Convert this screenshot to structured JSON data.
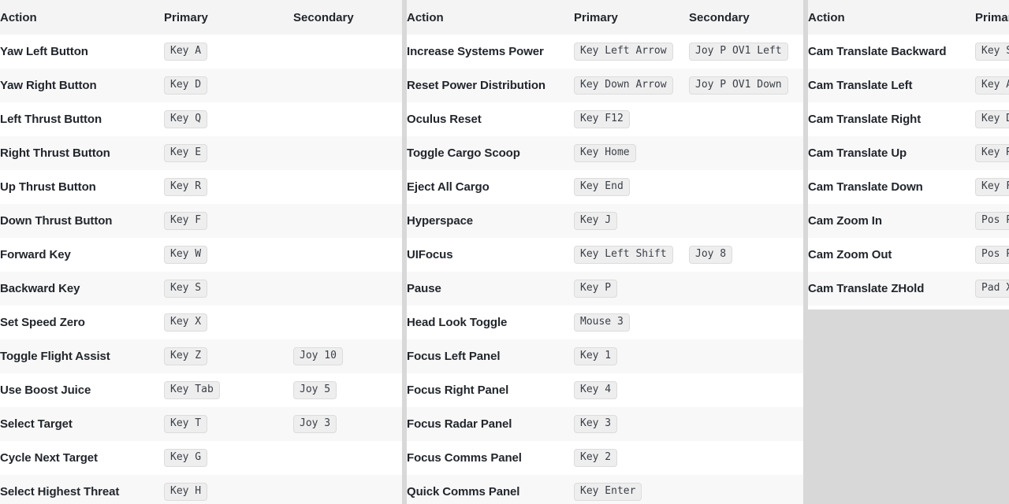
{
  "page": {
    "background_color": "#d8d8d8",
    "table_background": "#ffffff",
    "header_background": "#f4f4f4",
    "row_alt_background": "#f8f8f8",
    "badge_background": "#eeeeee",
    "badge_border_color": "#dcdcdc",
    "text_color": "#22262c"
  },
  "columns": [
    {
      "id": "column-1",
      "headers": {
        "action": "Action",
        "primary": "Primary",
        "secondary": "Secondary"
      },
      "rows": [
        {
          "action": "Yaw Left Button",
          "primary": "Key A",
          "secondary": ""
        },
        {
          "action": "Yaw Right Button",
          "primary": "Key D",
          "secondary": ""
        },
        {
          "action": "Left Thrust Button",
          "primary": "Key Q",
          "secondary": ""
        },
        {
          "action": "Right Thrust Button",
          "primary": "Key E",
          "secondary": ""
        },
        {
          "action": "Up Thrust Button",
          "primary": "Key R",
          "secondary": ""
        },
        {
          "action": "Down Thrust Button",
          "primary": "Key F",
          "secondary": ""
        },
        {
          "action": "Forward Key",
          "primary": "Key W",
          "secondary": ""
        },
        {
          "action": "Backward Key",
          "primary": "Key S",
          "secondary": ""
        },
        {
          "action": "Set Speed Zero",
          "primary": "Key X",
          "secondary": ""
        },
        {
          "action": "Toggle Flight Assist",
          "primary": "Key Z",
          "secondary": "Joy 10"
        },
        {
          "action": "Use Boost Juice",
          "primary": "Key Tab",
          "secondary": "Joy 5"
        },
        {
          "action": "Select Target",
          "primary": "Key T",
          "secondary": "Joy 3"
        },
        {
          "action": "Cycle Next Target",
          "primary": "Key G",
          "secondary": ""
        },
        {
          "action": "Select Highest Threat",
          "primary": "Key H",
          "secondary": ""
        }
      ]
    },
    {
      "id": "column-2",
      "headers": {
        "action": "Action",
        "primary": "Primary",
        "secondary": "Secondary"
      },
      "rows": [
        {
          "action": "Increase Systems Power",
          "primary": "Key Left Arrow",
          "secondary": "Joy P OV1 Left"
        },
        {
          "action": "Reset Power Distribution",
          "primary": "Key Down Arrow",
          "secondary": "Joy P OV1 Down"
        },
        {
          "action": "Oculus Reset",
          "primary": "Key F12",
          "secondary": ""
        },
        {
          "action": "Toggle Cargo Scoop",
          "primary": "Key Home",
          "secondary": ""
        },
        {
          "action": "Eject All Cargo",
          "primary": "Key End",
          "secondary": ""
        },
        {
          "action": "Hyperspace",
          "primary": "Key J",
          "secondary": ""
        },
        {
          "action": "UIFocus",
          "primary": "Key Left Shift",
          "secondary": "Joy 8"
        },
        {
          "action": "Pause",
          "primary": "Key P",
          "secondary": ""
        },
        {
          "action": "Head Look Toggle",
          "primary": "Mouse 3",
          "secondary": ""
        },
        {
          "action": "Focus Left Panel",
          "primary": "Key 1",
          "secondary": ""
        },
        {
          "action": "Focus Right Panel",
          "primary": "Key 4",
          "secondary": ""
        },
        {
          "action": "Focus Radar Panel",
          "primary": "Key 3",
          "secondary": ""
        },
        {
          "action": "Focus Comms Panel",
          "primary": "Key 2",
          "secondary": ""
        },
        {
          "action": "Quick Comms Panel",
          "primary": "Key Enter",
          "secondary": ""
        }
      ]
    },
    {
      "id": "column-3",
      "headers": {
        "action": "Action",
        "primary": "Primary",
        "secondary": ""
      },
      "rows": [
        {
          "action": "Cam Translate Backward",
          "primary": "Key S",
          "secondary": ""
        },
        {
          "action": "Cam Translate Left",
          "primary": "Key A",
          "secondary": ""
        },
        {
          "action": "Cam Translate Right",
          "primary": "Key D",
          "secondary": ""
        },
        {
          "action": "Cam Translate Up",
          "primary": "Key R",
          "secondary": ""
        },
        {
          "action": "Cam Translate Down",
          "primary": "Key F",
          "secondary": ""
        },
        {
          "action": "Cam Zoom In",
          "primary": "Pos Pa",
          "secondary": ""
        },
        {
          "action": "Cam Zoom Out",
          "primary": "Pos Pa",
          "secondary": ""
        },
        {
          "action": "Cam Translate ZHold",
          "primary": "Pad X",
          "secondary": ""
        }
      ]
    }
  ]
}
